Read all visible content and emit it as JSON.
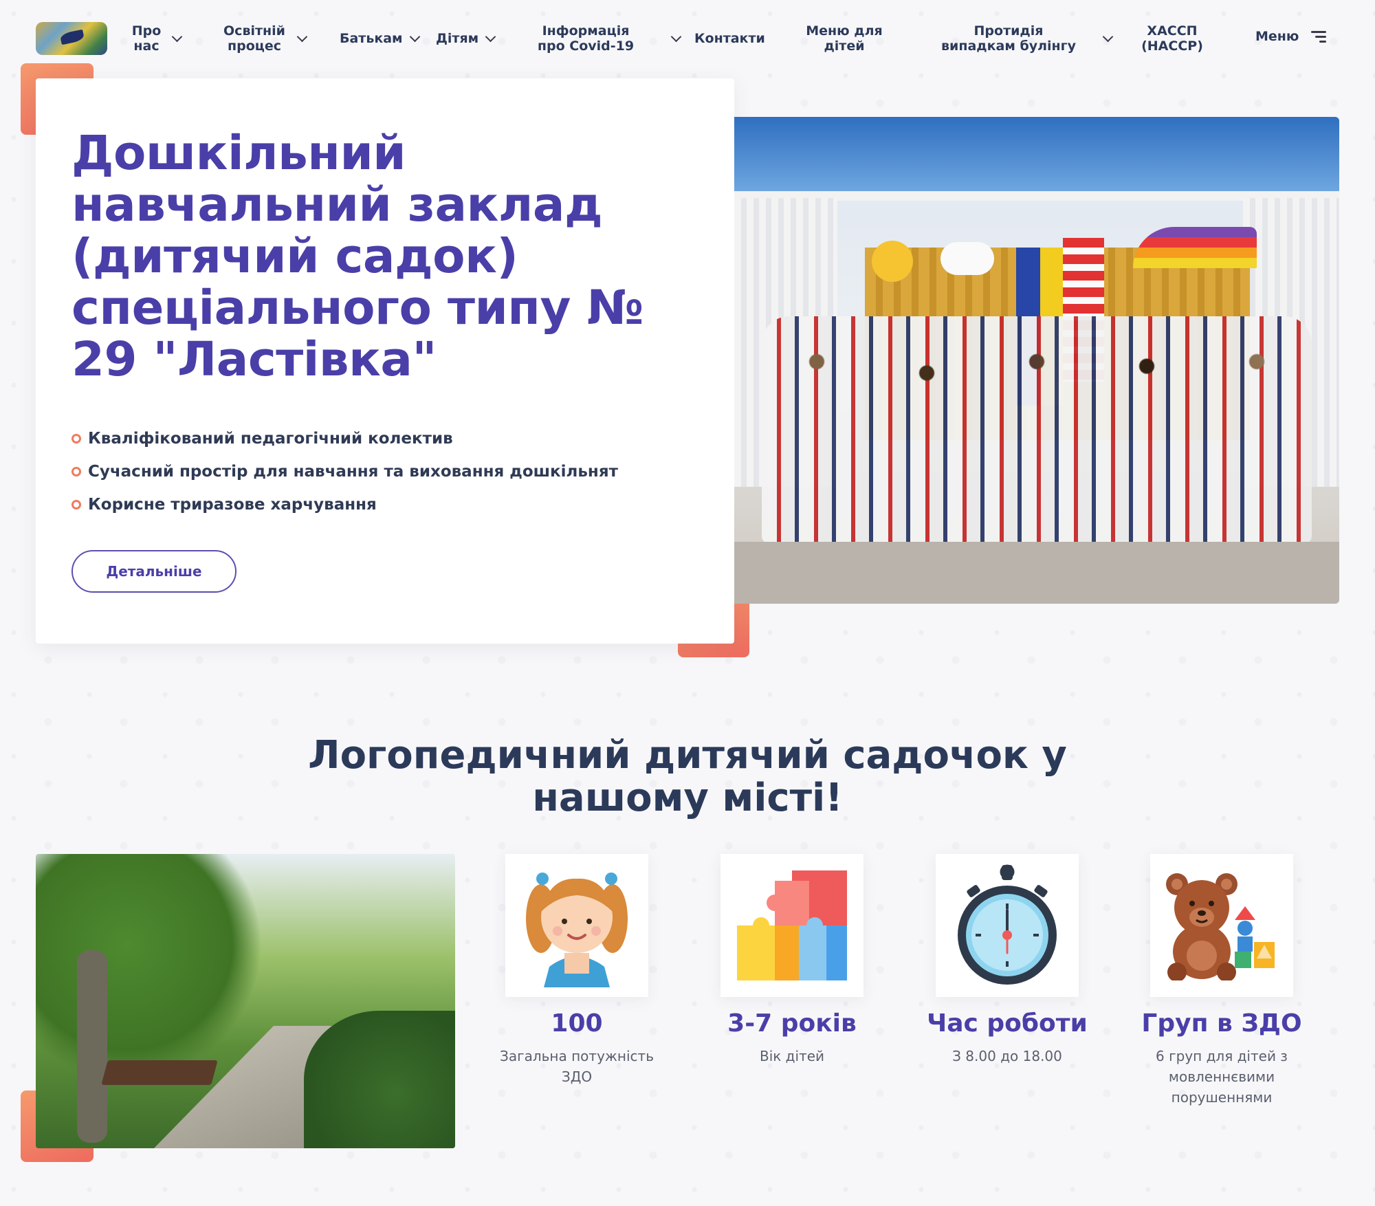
{
  "nav": {
    "items": [
      {
        "label": "Про нас",
        "has_dropdown": true
      },
      {
        "label": "Освітній процес",
        "has_dropdown": true
      },
      {
        "label": "Батькам",
        "has_dropdown": true
      },
      {
        "label": "Дітям",
        "has_dropdown": true
      },
      {
        "label": "Інформація про Covid-19",
        "has_dropdown": true
      },
      {
        "label": "Контакти",
        "has_dropdown": false
      },
      {
        "label": "Меню для дітей",
        "has_dropdown": false
      },
      {
        "label": "Протидія випадкам булінгу",
        "has_dropdown": true
      },
      {
        "label": "ХАССП (HACCP)",
        "has_dropdown": false
      }
    ],
    "menu_label": "Меню"
  },
  "hero": {
    "title": "Дошкільний навчальний заклад (дитячий садок) спеціального типу № 29 \"Ластівка\"",
    "features": [
      "Кваліфікований педагогічний колектив",
      "Сучасний простір для навчання та виховання дошкільнят",
      "Корисне триразове харчування"
    ],
    "button_label": "Детальніше"
  },
  "section": {
    "title": "Логопедичний дитячий садочок у нашому місті!",
    "stats": [
      {
        "value": "100",
        "desc": "Загальна потужність ЗДО",
        "icon": "girl-icon"
      },
      {
        "value": "3-7 років",
        "desc": "Вік дітей",
        "icon": "puzzle-icon"
      },
      {
        "value": "Час роботи",
        "desc": "З 8.00 до 18.00",
        "icon": "stopwatch-icon"
      },
      {
        "value": "Груп в ЗДО",
        "desc": "6 груп для дітей з мовленнєвими порушеннями",
        "icon": "teddy-bear-icon"
      }
    ]
  },
  "colors": {
    "brand_purple": "#4a3fa8",
    "accent_orange": "#f07b5f",
    "heading_dark": "#2c3a5a"
  }
}
